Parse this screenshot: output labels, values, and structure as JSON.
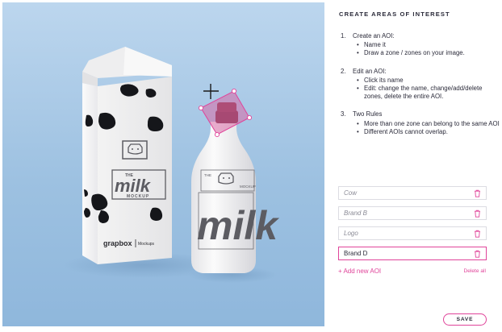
{
  "canvas": {
    "carton_watermark": {
      "small": "THE",
      "big": "milk",
      "sub": "MOCKUP"
    },
    "brand_text": "grapbox",
    "brand_small": "Mockups",
    "bottle_watermark": {
      "big": "milk",
      "small_lines": [
        "THE",
        "MOCKUP"
      ]
    }
  },
  "panel": {
    "title": "CREATE AREAS OF INTEREST",
    "steps": [
      {
        "num": "1.",
        "label": "Create an AOI:",
        "bullets": [
          "Name it",
          "Draw a zone / zones on your image."
        ]
      },
      {
        "num": "2.",
        "label": "Edit an AOI:",
        "bullets": [
          "Click its name",
          "Edit: change the name, change/add/delete zones, delete the entire AOI."
        ]
      },
      {
        "num": "3.",
        "label": "Two Rules",
        "bullets": [
          "More than one zone can belong to the same AOI",
          "Different AOIs cannot overlap."
        ]
      }
    ],
    "aois": [
      {
        "name": "Cow",
        "active": false
      },
      {
        "name": "Brand B",
        "active": false
      },
      {
        "name": "Logo",
        "active": false
      },
      {
        "name": "Brand D",
        "active": true
      }
    ],
    "add_label": "+ Add new AOI",
    "delete_all_label": "Delete all",
    "save_label": "SAVE"
  },
  "colors": {
    "accent": "#e0449a",
    "background_blue": "#a9c8e4",
    "aoi_fill": "#d86aa6"
  },
  "icons": {
    "trash": "trash-icon",
    "crosshair": "crosshair-cursor-icon"
  }
}
